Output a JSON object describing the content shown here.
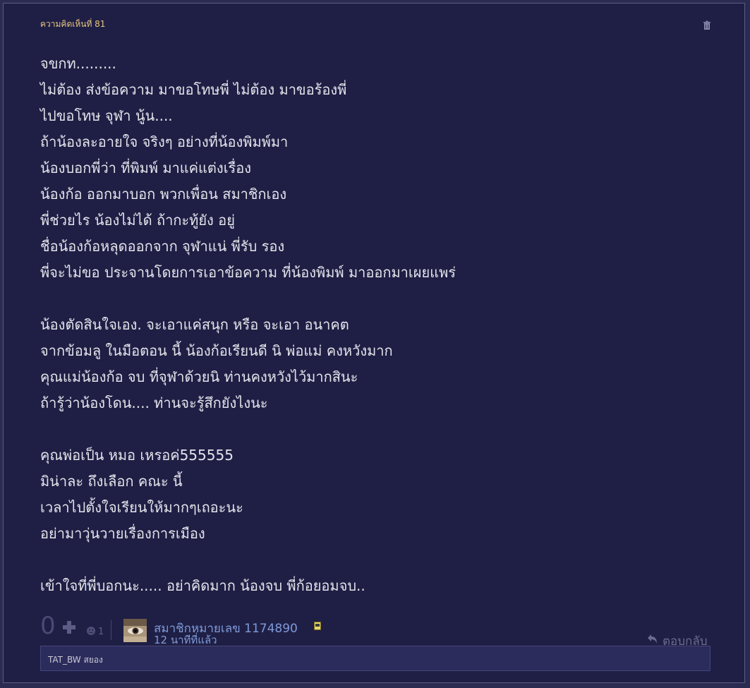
{
  "comment": {
    "number_label": "ความคิดเห็นที่ 81",
    "body_lines": [
      "จขกท.........",
      "ไม่ต้อง ส่งข้อความ มาขอโทษพี่ ไม่ต้อง มาขอร้องพี่",
      "ไปขอโทษ จุฬา นู้น....",
      "ถ้าน้องละอายใจ จริงๆ อย่างที่น้องพิมพ์มา",
      "น้องบอกพี่ว่า ที่พิมพ์ มาแค่แต่งเรื่อง",
      "น้องก้อ ออกมาบอก พวกเพื่อน สมาชิกเอง",
      "พี่ช่วยไร น้องไม่ได้ ถ้ากะทู้ยัง อยู่",
      "ชื่อน้องก้อหลุดออกจาก จุฬาแน่ พี่รับ รอง",
      "พี่จะไม่ขอ ประจานโดยการเอาข้อความ ที่น้องพิมพ์ มาออกมาเผยแพร่",
      "",
      "น้องตัดสินใจเอง. จะเอาแค่สนุก หรือ จะเอา อนาคต",
      "จากข้อมลู ในมือตอน นี้ น้องก้อเรียนดี นิ พ่อแม่ คงหวังมาก",
      "คุณแม่น้องก้อ จบ ที่จุฬาด้วยนิ ท่านคงหวังไว้มากสินะ",
      "ถ้ารู้ว่าน้องโดน.... ท่านจะรู้สึกยังไงนะ",
      "",
      "คุณพ่อเป็น หมอ เหรอค่555555",
      "มิน่าละ ถึงเลือก คณะ นี้",
      "เวลาไปตั้งใจเรียนให้มากๆเถอะนะ",
      "อย่ามาวุ่นวายเรื่องการเมือง",
      "",
      "เข้าใจที่พี่บอกนะ..... อย่าคิดมาก น้องจบ พี่ก้อยอมจบ.."
    ],
    "vote_count": "0",
    "emoji_count": "1",
    "author": "สมาชิกหมายเลข 1174890",
    "timestamp": "12 นาทีที่แล้ว",
    "reply_label": "ตอบกลับ",
    "subcomment_text": "TAT_BW สยอง"
  },
  "icons": {
    "trash": "trash-icon",
    "plus": "plus-icon",
    "emoji": "emoji-icon",
    "badge": "member-badge-icon",
    "reply": "reply-arrow-icon"
  },
  "colors": {
    "background": "#1f1f45",
    "comment_number": "#e8c680",
    "body_text": "#e4e4ec",
    "author": "#7f9ad8"
  }
}
